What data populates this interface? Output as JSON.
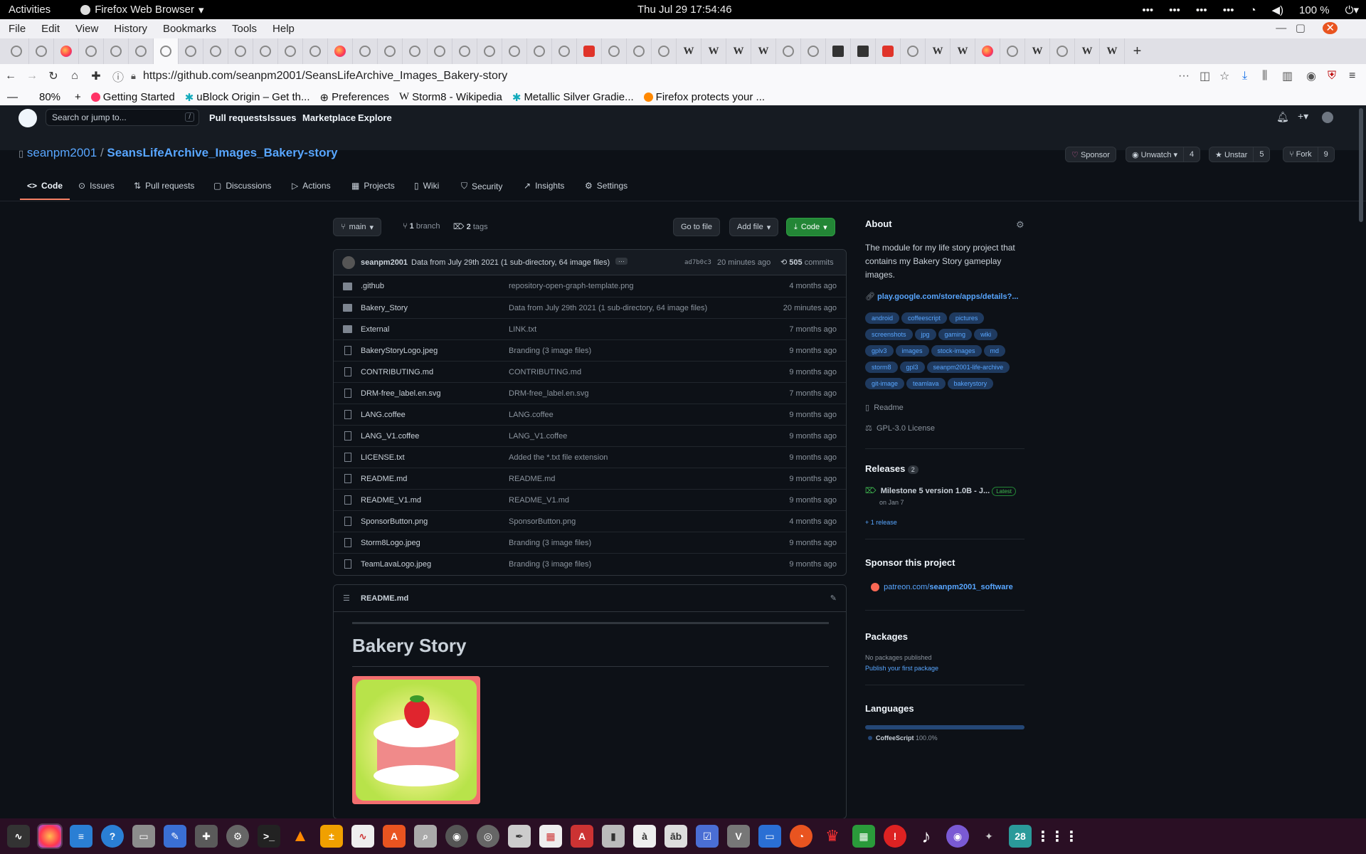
{
  "system": {
    "activities": "Activities",
    "app_name": "Firefox Web Browser",
    "clock": "Thu Jul 29  17:54:46",
    "battery": "100 %"
  },
  "menu": [
    "File",
    "Edit",
    "View",
    "History",
    "Bookmarks",
    "Tools",
    "Help"
  ],
  "url": "https://github.com/seanpm2001/SeansLifeArchive_Images_Bakery-story",
  "zoom": "80%",
  "bookmarks": [
    "Getting Started",
    "uBlock Origin – Get th...",
    "Preferences",
    "Storm8 - Wikipedia",
    "Metallic Silver Gradie...",
    "Firefox protects your ..."
  ],
  "github": {
    "search_placeholder": "Search or jump to...",
    "slash": "/",
    "nav": [
      "Pull requests",
      "Issues",
      "Marketplace",
      "Explore"
    ]
  },
  "repo": {
    "owner": "seanpm2001",
    "sep": "/",
    "name": "SeansLifeArchive_Images_Bakery-story",
    "sponsor": "Sponsor",
    "unwatch": "Unwatch",
    "watch_count": "4",
    "unstar": "Unstar",
    "star_count": "5",
    "fork": "Fork",
    "fork_count": "9",
    "tabs": [
      "Code",
      "Issues",
      "Pull requests",
      "Discussions",
      "Actions",
      "Projects",
      "Wiki",
      "Security",
      "Insights",
      "Settings"
    ]
  },
  "branchbar": {
    "branch": "main",
    "branches_n": "1",
    "branches_word": "branch",
    "tags_n": "2",
    "tags_word": "tags",
    "goto": "Go to file",
    "addfile": "Add file",
    "code": "Code"
  },
  "commit": {
    "author": "seanpm2001",
    "message": "Data from July 29th 2021 (1 sub-directory, 64 image files)",
    "ellipsis": "···",
    "sha": "ad7b0c3",
    "time": "20 minutes ago",
    "count": "505",
    "count_word": "commits"
  },
  "files": [
    {
      "name": ".github",
      "msg": "repository-open-graph-template.png",
      "age": "4 months ago",
      "dir": true
    },
    {
      "name": "Bakery_Story",
      "msg": "Data from July 29th 2021 (1 sub-directory, 64 image files)",
      "age": "20 minutes ago",
      "dir": true
    },
    {
      "name": "External",
      "msg": "LINK.txt",
      "age": "7 months ago",
      "dir": true
    },
    {
      "name": "BakeryStoryLogo.jpeg",
      "msg": "Branding (3 image files)",
      "age": "9 months ago",
      "dir": false
    },
    {
      "name": "CONTRIBUTING.md",
      "msg": "CONTRIBUTING.md",
      "age": "9 months ago",
      "dir": false
    },
    {
      "name": "DRM-free_label.en.svg",
      "msg": "DRM-free_label.en.svg",
      "age": "7 months ago",
      "dir": false
    },
    {
      "name": "LANG.coffee",
      "msg": "LANG.coffee",
      "age": "9 months ago",
      "dir": false
    },
    {
      "name": "LANG_V1.coffee",
      "msg": "LANG_V1.coffee",
      "age": "9 months ago",
      "dir": false
    },
    {
      "name": "LICENSE.txt",
      "msg": "Added the *.txt file extension",
      "age": "9 months ago",
      "dir": false
    },
    {
      "name": "README.md",
      "msg": "README.md",
      "age": "9 months ago",
      "dir": false
    },
    {
      "name": "README_V1.md",
      "msg": "README_V1.md",
      "age": "9 months ago",
      "dir": false
    },
    {
      "name": "SponsorButton.png",
      "msg": "SponsorButton.png",
      "age": "4 months ago",
      "dir": false
    },
    {
      "name": "Storm8Logo.jpeg",
      "msg": "Branding (3 image files)",
      "age": "9 months ago",
      "dir": false
    },
    {
      "name": "TeamLavaLogo.jpeg",
      "msg": "Branding (3 image files)",
      "age": "9 months ago",
      "dir": false
    }
  ],
  "readme": {
    "filename": "README.md",
    "title": "Bakery Story"
  },
  "about": {
    "heading": "About",
    "description": "The module for my life story project that contains my Bakery Story gameplay images.",
    "link": "play.google.com/store/apps/details?...",
    "topics": [
      "android",
      "coffeescript",
      "pictures",
      "screenshots",
      "jpg",
      "gaming",
      "wiki",
      "gplv3",
      "images",
      "stock-images",
      "md",
      "storm8",
      "gpl3",
      "seanpm2001-life-archive",
      "git-image",
      "teamlava",
      "bakerystory"
    ],
    "readme": "Readme",
    "license": "GPL-3.0 License"
  },
  "releases": {
    "heading": "Releases",
    "count": "2",
    "latest_name": "Milestone 5 version 1.0B - J...",
    "latest_badge": "Latest",
    "latest_date": "on Jan 7",
    "more": "+ 1 release"
  },
  "sponsor": {
    "heading": "Sponsor this project",
    "link_prefix": "patreon.com/",
    "link_bold": "seanpm2001_software"
  },
  "packages": {
    "heading": "Packages",
    "none": "No packages published",
    "publish": "Publish your first package"
  },
  "languages": {
    "heading": "Languages",
    "name": "CoffeeScript",
    "pct": "100.0%",
    "fraction": 1.0,
    "color": "#244776"
  },
  "taskbar_badge": "28"
}
